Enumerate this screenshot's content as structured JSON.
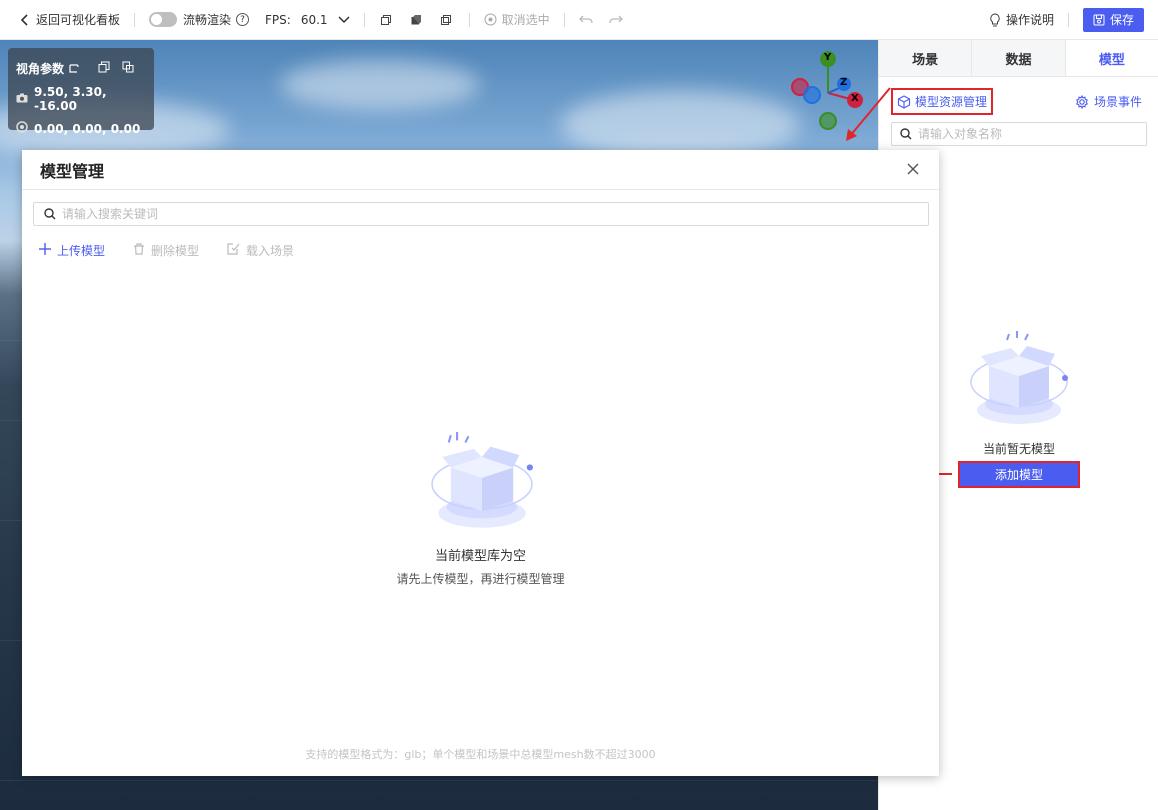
{
  "topbar": {
    "back_label": "返回可视化看板",
    "smooth_render_label": "流畅渲染",
    "help_mark": "?",
    "fps_label": "FPS:",
    "fps_value": "60.1",
    "deselect_label": "取消选中",
    "instructions_label": "操作说明",
    "save_label": "保存"
  },
  "view_params": {
    "title": "视角参数",
    "camera_position": "9.50, 3.30, -16.00",
    "target_position": "0.00, 0.00, 0.00"
  },
  "gizmo": {
    "x": "X",
    "y": "Y",
    "z": "Z"
  },
  "right_panel": {
    "tabs": [
      {
        "label": "场景",
        "active": false
      },
      {
        "label": "数据",
        "active": false
      },
      {
        "label": "模型",
        "active": true
      }
    ],
    "model_resource_label": "模型资源管理",
    "scene_event_label": "场景事件",
    "search_placeholder": "请输入对象名称",
    "empty_text": "当前暂无模型",
    "add_model_label": "添加模型"
  },
  "modal": {
    "title": "模型管理",
    "search_placeholder": "请输入搜索关键词",
    "actions": [
      {
        "label": "上传模型",
        "enabled": true
      },
      {
        "label": "删除模型",
        "enabled": false
      },
      {
        "label": "载入场景",
        "enabled": false
      }
    ],
    "empty_title": "当前模型库为空",
    "empty_subtitle": "请先上传模型，再进行模型管理",
    "footnote": "支持的模型格式为：glb；单个模型和场景中总模型mesh数不超过3000"
  },
  "colors": {
    "accent": "#4b5cf0",
    "highlight_red": "#e0262c"
  }
}
